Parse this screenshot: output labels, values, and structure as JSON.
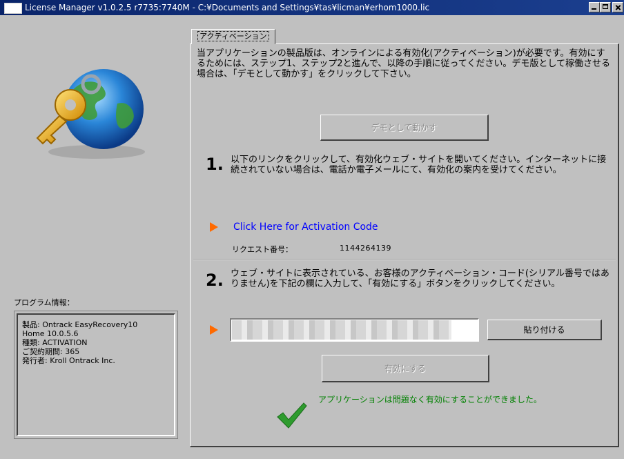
{
  "window": {
    "title": "License Manager v1.0.2.5 r7735:7740M - C:¥Documents and Settings¥tas¥licman¥erhom1000.lic"
  },
  "sidebar": {
    "logo_icon": "key-globe-icon",
    "info_label": "プログラム情報：",
    "info_lines": [
      "製品: Ontrack EasyRecovery10",
      "Home 10.0.5.6",
      "種類: ACTIVATION",
      "ご契約期間: 365",
      "発行者: Kroll Ontrack Inc."
    ]
  },
  "tabs": [
    {
      "label": "アクティベーション",
      "active": true
    }
  ],
  "main": {
    "intro": "当アプリケーションの製品版は、オンラインによる有効化(アクティベーション)が必要です。有効にするためには、ステップ1、ステップ2と進んで、以降の手順に従ってください。デモ版として稼働させる場合は、「デモとして動かす」をクリックして下さい。",
    "demo_button": "デモとして動かす",
    "step1": {
      "number": "1.",
      "text": "以下のリンクをクリックして、有効化ウェブ・サイトを開いてください。インターネットに接続されていない場合は、電話か電子メールにて、有効化の案内を受けてください。",
      "link": "Click Here for Activation Code",
      "request_label": "リクエスト番号：",
      "request_number": "1144264139"
    },
    "step2": {
      "number": "2.",
      "text": "ウェブ・サイトに表示されている、お客様のアクティベーション・コード(シリアル番号ではありません)を下記の欄に入力して、「有効にする」ボタンをクリックしてください。",
      "code_value": "",
      "paste_button": "貼り付ける",
      "activate_button": "有効にする",
      "success_message": "アプリケーションは問題なく有効にすることができました。"
    }
  },
  "colors": {
    "accent_arrow": "#ff6a00",
    "link": "#0000ff",
    "success": "#008000",
    "titlebar": "#0a246a"
  }
}
